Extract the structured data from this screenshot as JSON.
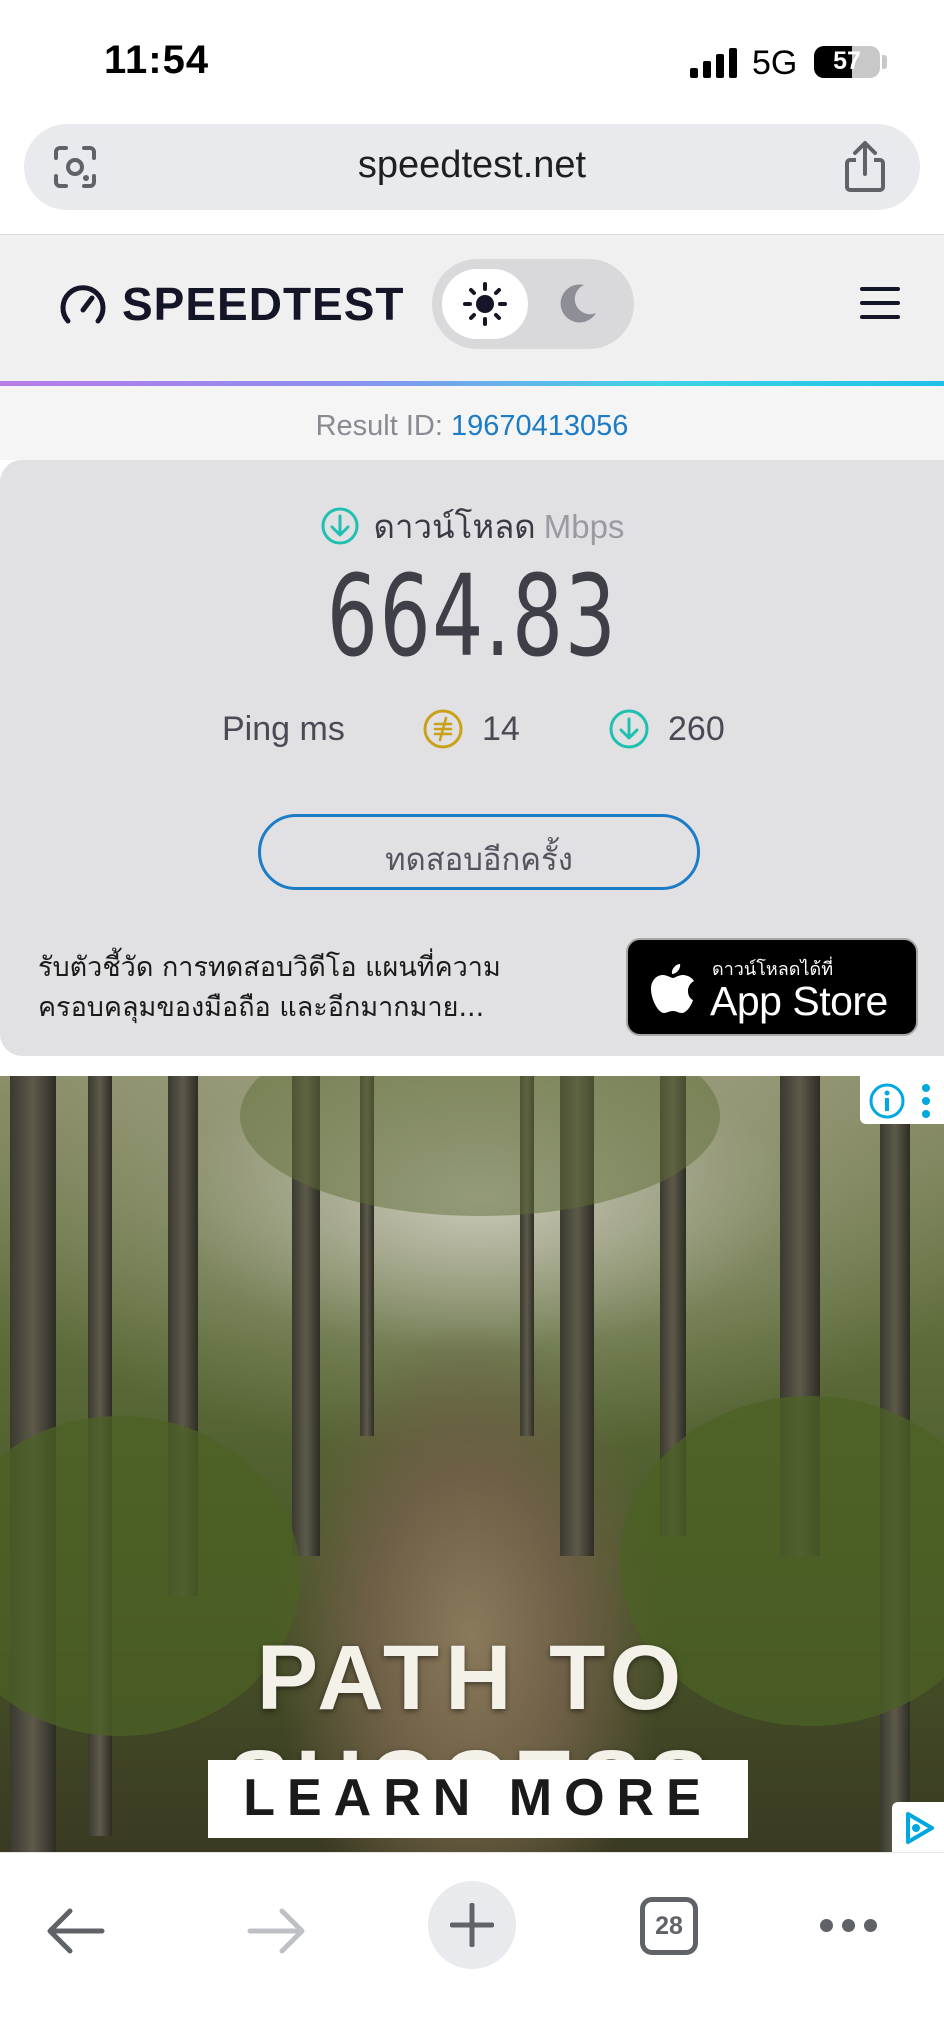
{
  "status_bar": {
    "time": "11:54",
    "network": "5G",
    "battery_percent": "57",
    "battery_level": 0.57
  },
  "address_bar": {
    "url": "speedtest.net",
    "left_icon": "google-lens-icon",
    "right_icon": "share-icon"
  },
  "site_header": {
    "logo_text": "SPEEDTEST",
    "logo_icon": "speedometer-gauge-icon",
    "theme_toggle": {
      "active": "light",
      "light_icon": "sun-icon",
      "dark_icon": "moon-icon"
    },
    "menu_icon": "hamburger-menu-icon",
    "accent_gradient": [
      "#b77ce8",
      "#3fd4e6"
    ]
  },
  "result": {
    "id_label": "Result ID:",
    "id_value": "19670413056"
  },
  "download": {
    "label": "ดาวน์โหลด",
    "unit": "Mbps",
    "value": "664.83",
    "icon": "download-arrow-icon",
    "icon_color": "#1fc0b0"
  },
  "ping": {
    "label": "Ping",
    "unit": "ms",
    "idle_value": "14",
    "idle_icon": "idle-ping-icon",
    "idle_color": "#c9a21a",
    "download_value": "260",
    "download_icon": "download-ping-icon",
    "download_color": "#1fc0b0"
  },
  "retest_button": {
    "label": "ทดสอบอีกครั้ง",
    "border_color": "#1c7cc5"
  },
  "promo": {
    "text_line1": "รับตัวชี้วัด การทดสอบวิดีโอ แผนที่ความ",
    "text_line2": "ครอบคลุมของมือถือ และอีกมากมาย...",
    "badge_small": "ดาวน์โหลดได้ที่",
    "badge_big": "App Store",
    "badge_icon": "apple-logo-icon"
  },
  "ad": {
    "headline": "PATH TO SUCCESS",
    "cta": "LEARN MORE",
    "info_icon": "info-icon",
    "more_icon": "vertical-dots-icon",
    "adchoices_icon": "adchoices-icon"
  },
  "toolbar": {
    "back_icon": "back-arrow-icon",
    "forward_icon": "forward-arrow-icon",
    "new_tab_icon": "plus-icon",
    "tab_count": "28",
    "more_icon": "more-dots-icon"
  }
}
